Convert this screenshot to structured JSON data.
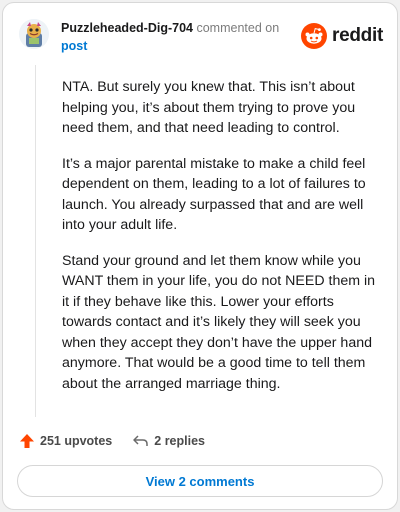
{
  "comment": {
    "username": "Puzzleheaded-Dig-704",
    "action_text": "commented on",
    "post_link": "post",
    "paragraphs": [
      "NTA. But surely you knew that. This isn’t about helping you, it’s about them trying to prove you need them, and that need leading to control.",
      "It’s a major parental mistake to make a child feel dependent on them, leading to a lot of failures to launch. You already surpassed that and are well into your adult life.",
      "Stand your ground and let them know while you WANT them in your life, you do not NEED them in it if they behave like this. Lower your efforts towards contact and it’s likely they will seek you when they accept they don’t have the upper hand anymore. That would be a good time to tell them about the arranged marriage thing."
    ],
    "upvotes_label": "251 upvotes",
    "replies_label": "2 replies"
  },
  "brand": {
    "name": "reddit",
    "color": "#ff4500",
    "icon": "reddit-logo-icon"
  },
  "footer": {
    "view_comments_label": "View 2 comments"
  },
  "colors": {
    "link": "#0079d3",
    "upvote": "#ff4500",
    "text": "#1a1a1b",
    "muted": "#7c7c7c"
  }
}
